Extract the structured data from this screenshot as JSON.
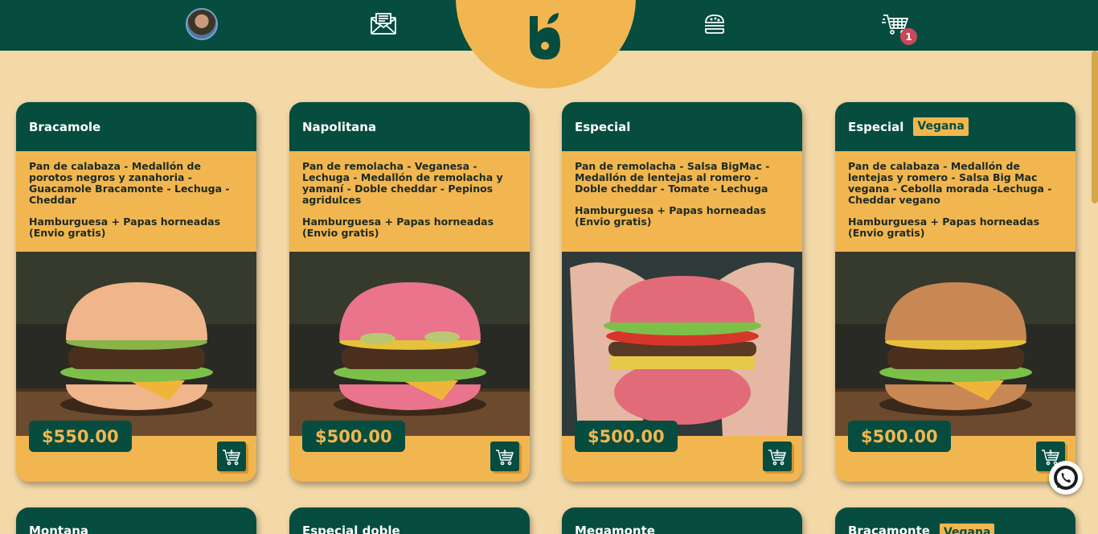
{
  "colors": {
    "primary": "#064d3f",
    "accent": "#f2b650",
    "background": "#f4d9a8",
    "badge": "#c9475a"
  },
  "nav": {
    "avatar_icon": "user-avatar",
    "mail_icon": "mail-icon",
    "logo_icon": "brand-logo",
    "burger_icon": "burger-icon",
    "cart_icon": "cart-icon",
    "cart_count": "1"
  },
  "products": [
    {
      "name": "Bracamole",
      "tag": "",
      "ingredients": "Pan de calabaza - Medallón de porotos negros y zanahoria - Guacamole Bracamonte - Lechuga - Cheddar",
      "combo": "Hamburguesa + Papas horneadas (Envio gratis)",
      "price": "$550.00",
      "bun_color": "#f0b58a"
    },
    {
      "name": "Napolitana",
      "tag": "",
      "ingredients": "Pan de remolacha - Veganesa - Lechuga - Medallón de remolacha y yamaní - Doble cheddar - Pepinos agridulces",
      "combo": "Hamburguesa + Papas horneadas (Envio gratis)",
      "price": "$500.00",
      "bun_color": "#e9748b"
    },
    {
      "name": "Especial",
      "tag": "",
      "ingredients": "Pan de remolacha - Salsa BigMac - Medallón de lentejas al romero - Doble cheddar - Tomate - Lechuga",
      "combo": "Hamburguesa + Papas horneadas (Envio gratis)",
      "price": "$500.00",
      "bun_color": "#e26b7a"
    },
    {
      "name": "Especial",
      "tag": "Vegana",
      "ingredients": "Pan de calabaza - Medallón de lentejas y romero - Salsa Big Mac vegana - Cebolla morada -Lechuga - Cheddar vegano",
      "combo": "Hamburguesa + Papas horneadas (Envio gratis)",
      "price": "$500.00",
      "bun_color": "#c98754"
    }
  ],
  "next_row": [
    {
      "name": "Montana",
      "tag": ""
    },
    {
      "name": "Especial doble",
      "tag": ""
    },
    {
      "name": "Megamonte",
      "tag": ""
    },
    {
      "name": "Bracamonte",
      "tag": "Vegana"
    }
  ],
  "whatsapp_icon": "whatsapp-icon"
}
